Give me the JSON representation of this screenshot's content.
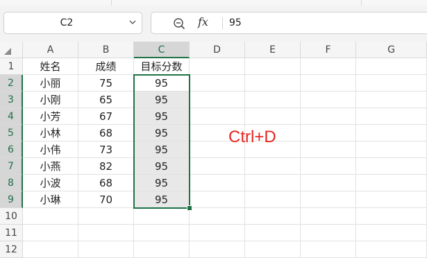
{
  "formula_bar": {
    "name_box": "C2",
    "formula": "95",
    "fx_label": "fx"
  },
  "columns": [
    "A",
    "B",
    "C",
    "D",
    "E",
    "F",
    "G"
  ],
  "rows": [
    "1",
    "2",
    "3",
    "4",
    "5",
    "6",
    "7",
    "8",
    "9",
    "10",
    "11",
    "12"
  ],
  "table": {
    "headers": [
      "姓名",
      "成绩",
      "目标分数"
    ],
    "data": [
      [
        "小丽",
        "75",
        "95"
      ],
      [
        "小刚",
        "65",
        "95"
      ],
      [
        "小芳",
        "67",
        "95"
      ],
      [
        "小林",
        "68",
        "95"
      ],
      [
        "小伟",
        "73",
        "95"
      ],
      [
        "小燕",
        "82",
        "95"
      ],
      [
        "小波",
        "68",
        "95"
      ],
      [
        "小琳",
        "70",
        "95"
      ]
    ]
  },
  "annotation": "Ctrl+D",
  "colors": {
    "selection": "#1e7145",
    "annotation": "#e8241f"
  }
}
